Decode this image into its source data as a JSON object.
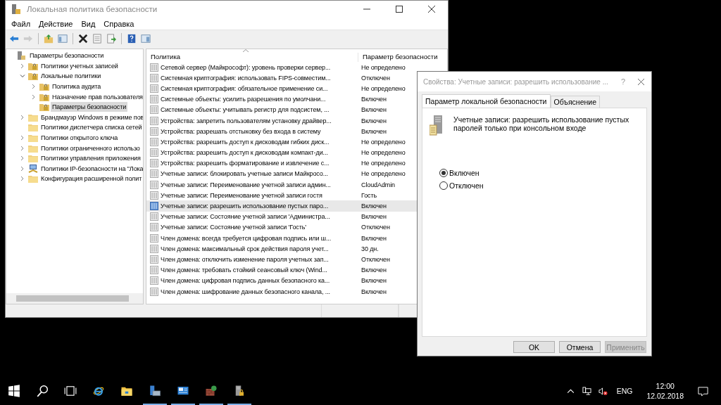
{
  "main_window": {
    "title": "Локальная политика безопасности",
    "menu": [
      "Файл",
      "Действие",
      "Вид",
      "Справка"
    ],
    "toolbar": [
      {
        "kind": "back",
        "disabled": false
      },
      {
        "kind": "forward",
        "disabled": true
      },
      {
        "kind": "sep"
      },
      {
        "kind": "up",
        "disabled": false
      },
      {
        "kind": "tree",
        "disabled": false
      },
      {
        "kind": "sep"
      },
      {
        "kind": "delete",
        "disabled": false
      },
      {
        "kind": "properties",
        "disabled": false
      },
      {
        "kind": "export",
        "disabled": false
      },
      {
        "kind": "sep"
      },
      {
        "kind": "help",
        "disabled": false
      },
      {
        "kind": "view",
        "disabled": false
      }
    ],
    "tree": {
      "label": "Параметры безопасности",
      "kind": "policy",
      "selected": false,
      "children": [
        {
          "label": "Политики учетных записей",
          "kind": "lock-folder",
          "expanded": false,
          "selected": false
        },
        {
          "label": "Локальные политики",
          "kind": "lock-folder",
          "expanded": true,
          "selected": false,
          "children": [
            {
              "label": "Политика аудита",
              "kind": "lock-folder",
              "expanded": false,
              "selected": false
            },
            {
              "label": "Назначение прав пользователя",
              "kind": "lock-folder",
              "expanded": false,
              "selected": false
            },
            {
              "label": "Параметры безопасности",
              "kind": "lock-folder",
              "selected": true
            }
          ]
        },
        {
          "label": "Брандмауэр Windows в режиме пов",
          "kind": "folder",
          "expanded": false,
          "selected": false
        },
        {
          "label": "Политики диспетчера списка сетей",
          "kind": "folder",
          "selected": false
        },
        {
          "label": "Политики открытого ключа",
          "kind": "folder",
          "expanded": false,
          "selected": false
        },
        {
          "label": "Политики ограниченного использо",
          "kind": "folder",
          "expanded": false,
          "selected": false
        },
        {
          "label": "Политики управления приложения",
          "kind": "folder",
          "expanded": false,
          "selected": false
        },
        {
          "label": "Политики IP-безопасности на \"Лока",
          "kind": "network",
          "expanded": false,
          "selected": false
        },
        {
          "label": "Конфигурация расширенной полит",
          "kind": "folder",
          "expanded": false,
          "selected": false
        }
      ]
    },
    "list": {
      "columns": [
        "Политика",
        "Параметр безопасности"
      ],
      "rows": [
        {
          "policy": "Сетевой сервер (Майкрософт): уровень проверки сервер...",
          "setting": "Не определено",
          "selected": false
        },
        {
          "policy": "Системная криптография: использовать FIPS-совместим...",
          "setting": "Отключен",
          "selected": false
        },
        {
          "policy": "Системная криптография: обязательное применение си...",
          "setting": "Не определено",
          "selected": false
        },
        {
          "policy": "Системные объекты: усилить разрешения по умолчани...",
          "setting": "Включен",
          "selected": false
        },
        {
          "policy": "Системные объекты: учитывать регистр для подсистем, ...",
          "setting": "Включен",
          "selected": false
        },
        {
          "policy": "Устройства: запретить пользователям установку драйвер...",
          "setting": "Включен",
          "selected": false
        },
        {
          "policy": "Устройства: разрешать отстыковку без входа в систему",
          "setting": "Включен",
          "selected": false
        },
        {
          "policy": "Устройства: разрешить доступ к дисководам гибких диск...",
          "setting": "Не определено",
          "selected": false
        },
        {
          "policy": "Устройства: разрешить доступ к дисководам компакт-ди...",
          "setting": "Не определено",
          "selected": false
        },
        {
          "policy": "Устройства: разрешить форматирование и извлечение с...",
          "setting": "Не определено",
          "selected": false
        },
        {
          "policy": "Учетные записи: блокировать учетные записи Майкросо...",
          "setting": "Не определено",
          "selected": false
        },
        {
          "policy": "Учетные записи: Переименование учетной записи админ...",
          "setting": "CloudAdmin",
          "selected": false
        },
        {
          "policy": "Учетные записи: Переименование учетной записи гостя",
          "setting": "Гость",
          "selected": false
        },
        {
          "policy": "Учетные записи: разрешить использование пустых паро...",
          "setting": "Включен",
          "selected": true
        },
        {
          "policy": "Учетные записи: Состояние учетной записи 'Администра...",
          "setting": "Включен",
          "selected": false
        },
        {
          "policy": "Учетные записи: Состояние учетной записи 'Гость'",
          "setting": "Отключен",
          "selected": false
        },
        {
          "policy": "Член домена: всегда требуется цифровая подпись или ш...",
          "setting": "Включен",
          "selected": false
        },
        {
          "policy": "Член домена: максимальный срок действия пароля учет...",
          "setting": "30 дн.",
          "selected": false
        },
        {
          "policy": "Член домена: отключить изменение пароля учетных зап...",
          "setting": "Отключен",
          "selected": false
        },
        {
          "policy": "Член домена: требовать стойкий сеансовый ключ (Wind...",
          "setting": "Включен",
          "selected": false
        },
        {
          "policy": "Член домена: цифровая подпись данных безопасного ка...",
          "setting": "Включен",
          "selected": false
        },
        {
          "policy": "Член домена: шифрование данных безопасного канала, ...",
          "setting": "Включен",
          "selected": false
        }
      ]
    }
  },
  "dialog": {
    "title": "Свойства: Учетные записи: разрешить использование ...",
    "help": "?",
    "tabs": [
      {
        "label": "Параметр локальной безопасности",
        "selected": true
      },
      {
        "label": "Объяснение",
        "selected": false
      }
    ],
    "description": "Учетные записи: разрешить использование пустых паролей только при консольном входе",
    "options": [
      {
        "label": "Включен",
        "selected": true
      },
      {
        "label": "Отключен",
        "selected": false
      }
    ],
    "buttons": [
      {
        "label": "OK",
        "disabled": false
      },
      {
        "label": "Отмена",
        "disabled": false
      },
      {
        "label": "Применить",
        "disabled": true
      }
    ]
  },
  "taskbar": {
    "apps": [
      {
        "kind": "ie",
        "running": false
      },
      {
        "kind": "explorer",
        "running": false
      },
      {
        "kind": "server-manager",
        "running": true
      },
      {
        "kind": "control-panel",
        "running": true
      },
      {
        "kind": "firewall",
        "running": true
      },
      {
        "kind": "security-policy",
        "running": true
      }
    ],
    "language": "ENG",
    "time": "12:00",
    "date": "12.02.2018"
  }
}
